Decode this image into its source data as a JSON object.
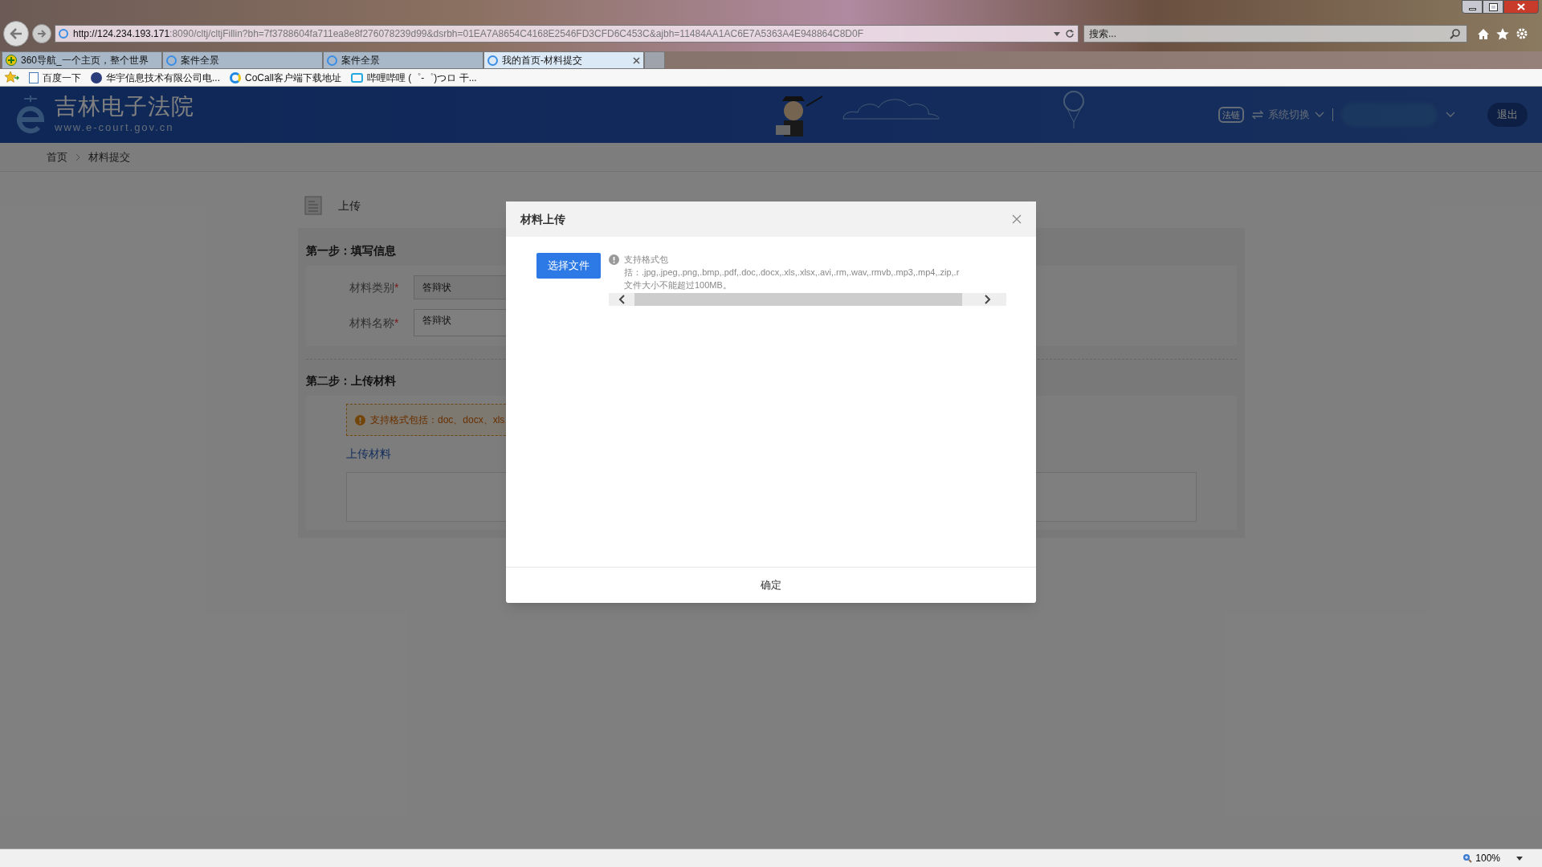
{
  "browser": {
    "address": {
      "host": "http://124.234.193.171",
      "rest": ":8090/cltj/cltjFillin?bh=7f3788604fa711ea8e8f276078239d99&dsrbh=01EA7A8654C4168E2546FD3CFD6C453C&ajbh=11484AA1AC6E7A5363A4E948864C8D0F"
    },
    "search": {
      "placeholder": "搜索..."
    },
    "tabs": [
      {
        "label": "360导航_一个主页，整个世界",
        "selected": false,
        "kind": "plus"
      },
      {
        "label": "案件全景",
        "selected": false,
        "kind": "ie"
      },
      {
        "label": "案件全景",
        "selected": false,
        "kind": "ie"
      },
      {
        "label": "我的首页-材料提交",
        "selected": true,
        "kind": "ie"
      }
    ],
    "favorites": [
      {
        "label": "百度一下",
        "kind": "page"
      },
      {
        "label": "华宇信息技术有限公司电...",
        "kind": "logo"
      },
      {
        "label": "CoCall客户端下载地址",
        "kind": "c"
      },
      {
        "label": "哔哩哔哩 (゜-゜)つロ 干...",
        "kind": "tv"
      }
    ],
    "zoom": "100%"
  },
  "header": {
    "title": "吉林电子法院",
    "subtitle": "www.e-court.gov.cn",
    "badge": "法链",
    "switch": "系统切换",
    "logout": "退出"
  },
  "breadcrumb": [
    "首页",
    "材料提交"
  ],
  "page": {
    "title": "上传",
    "step1": {
      "title": "第一步：填写信息",
      "fields": [
        {
          "label": "材料类别",
          "mark": "*",
          "value": "答辩状"
        },
        {
          "label": "材料名称",
          "mark": "*",
          "value": "答辩状"
        }
      ]
    },
    "step2": {
      "title": "第二步：上传材料",
      "notice": "支持格式包括：doc、docx、xls、",
      "link": "上传材料"
    }
  },
  "dialog": {
    "title": "材料上传",
    "choose": "选择文件",
    "hint": [
      "支持格式包",
      "括：.jpg,.jpeg,.png,.bmp,.pdf,.doc,.docx,.xls,.xlsx,.avi,.rm,.wav,.rmvb,.mp3,.mp4,.zip,.r",
      "文件大小不能超过100MB。"
    ],
    "confirm": "确定"
  }
}
